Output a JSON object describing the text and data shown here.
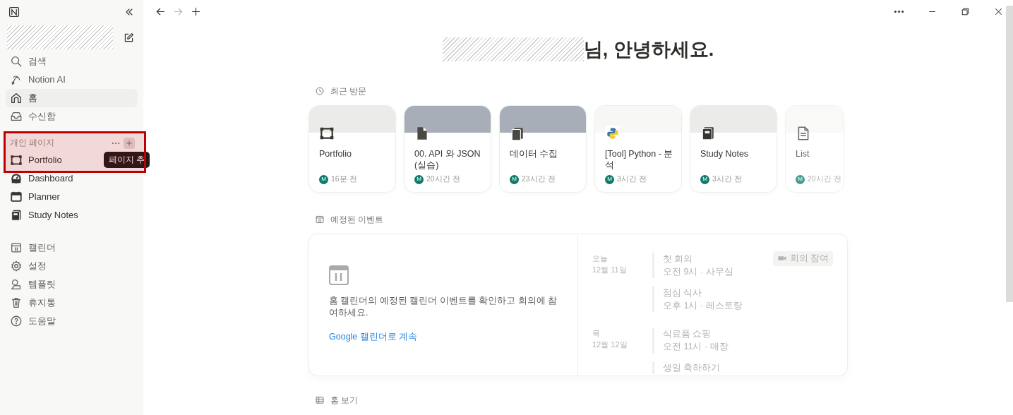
{
  "sidebar": {
    "nav": [
      {
        "label": "검색",
        "selected": false
      },
      {
        "label": "Notion AI",
        "selected": false
      },
      {
        "label": "홈",
        "selected": true
      },
      {
        "label": "수신함",
        "selected": false
      }
    ],
    "section": {
      "title": "개인 페이지",
      "tooltip": "페이지 추",
      "pages": [
        {
          "label": "Portfolio"
        },
        {
          "label": "Dashboard"
        },
        {
          "label": "Planner"
        },
        {
          "label": "Study Notes"
        }
      ]
    },
    "footer": [
      {
        "label": "캘린더"
      },
      {
        "label": "설정"
      },
      {
        "label": "템플릿"
      },
      {
        "label": "휴지통"
      },
      {
        "label": "도움말"
      }
    ]
  },
  "greeting": "님, 안녕하세요.",
  "recent": {
    "title": "최근 방문",
    "cards": [
      {
        "title": "Portfolio",
        "avatar": "M",
        "time": "16분 전",
        "color": "#ebebea"
      },
      {
        "title": "00. API 와 JSON (실습)",
        "avatar": "M",
        "time": "20시간 전",
        "color": "#a7aeb7"
      },
      {
        "title": "데이터 수집",
        "avatar": "M",
        "time": "23시간 전",
        "color": "#a7aeb7"
      },
      {
        "title": "[Tool] Python - 분석",
        "avatar": "M",
        "time": "3시간 전",
        "color": "#f7f7f6"
      },
      {
        "title": "Study Notes",
        "avatar": "M",
        "time": "3시간 전",
        "color": "#ebebea"
      },
      {
        "title": "List",
        "avatar": "M",
        "time": "20시간 전",
        "color": "#f7f7f6"
      }
    ]
  },
  "events": {
    "title": "예정된 이벤트",
    "message": "홈 캘린더의 예정된 캘린더 이벤트를 확인하고 회의에 참여하세요.",
    "link": "Google 캘린더로 계속",
    "days": [
      {
        "day": "오늘",
        "date": "12월 11일",
        "items": [
          {
            "title": "첫 회의",
            "detail": "오전 9시 · 사무실",
            "join": "회의 참여"
          },
          {
            "title": "점심 식사",
            "detail": "오후 1시 · 레스토랑"
          }
        ]
      },
      {
        "day": "목",
        "date": "12월 12일",
        "items": [
          {
            "title": "식료품 쇼핑",
            "detail": "오전 11시 · 매장"
          },
          {
            "title": "생일 축하하기"
          }
        ]
      }
    ]
  },
  "home_view": {
    "title": "홈 보기"
  }
}
